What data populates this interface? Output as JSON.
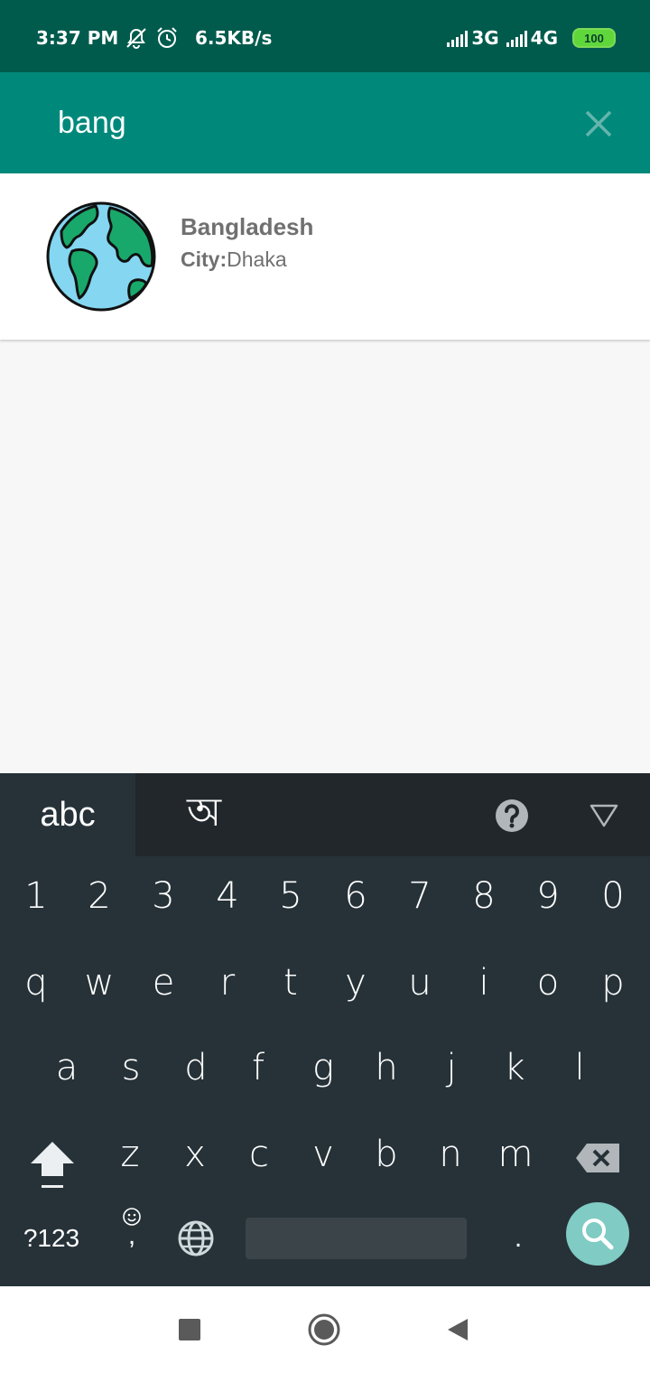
{
  "status_bar": {
    "time": "3:37 PM",
    "network_speed": "6.5KB/s",
    "net1": "3G",
    "net2": "4G",
    "battery": "100",
    "icons": [
      "mute-icon",
      "alarm-icon",
      "signal-icon",
      "battery-icon"
    ]
  },
  "search": {
    "query": "bang",
    "close_icon": "close-icon"
  },
  "result": {
    "icon": "globe-icon",
    "country": "Bangladesh",
    "city_label": "City:",
    "city": "Dhaka"
  },
  "keyboard": {
    "tab_abc": "abc",
    "tab_bangla": "অ",
    "numbers": [
      "1",
      "2",
      "3",
      "4",
      "5",
      "6",
      "7",
      "8",
      "9",
      "0"
    ],
    "row1": [
      "q",
      "w",
      "e",
      "r",
      "t",
      "y",
      "u",
      "i",
      "o",
      "p"
    ],
    "row2": [
      "a",
      "s",
      "d",
      "f",
      "g",
      "h",
      "j",
      "k",
      "l"
    ],
    "row3": [
      "z",
      "x",
      "c",
      "v",
      "b",
      "n",
      "m"
    ],
    "symbols_label": "?123",
    "comma": ",",
    "period": ".",
    "colors": {
      "background": "#263238",
      "action": "#80cbc4"
    }
  },
  "colors": {
    "status_bar": "#005b4d",
    "toolbar": "#00897b",
    "text_secondary": "#707070"
  }
}
